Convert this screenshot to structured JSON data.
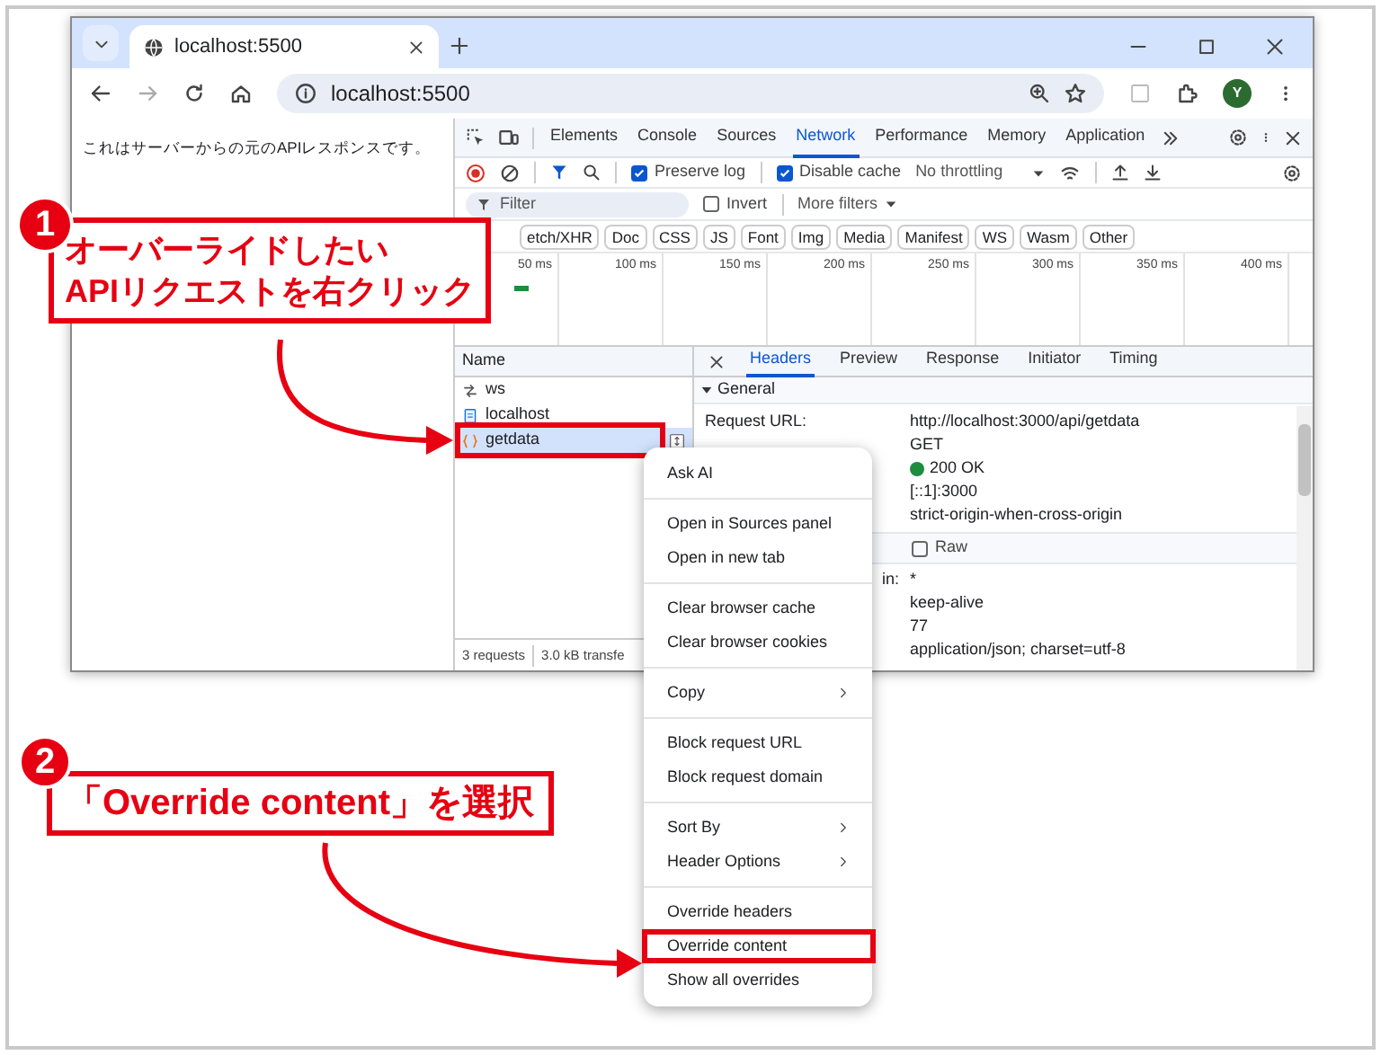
{
  "browser": {
    "tabs": [
      {
        "title": "localhost:5500",
        "selected": true
      }
    ],
    "address": "localhost:5500",
    "profile_initial": "Y"
  },
  "page": {
    "text": "これはサーバーからの元のAPIレスポンスです。"
  },
  "devtools": {
    "tabs": [
      {
        "label": "Elements",
        "selected": false
      },
      {
        "label": "Console",
        "selected": false
      },
      {
        "label": "Sources",
        "selected": false
      },
      {
        "label": "Network",
        "selected": true
      },
      {
        "label": "Performance",
        "selected": false
      },
      {
        "label": "Memory",
        "selected": false
      },
      {
        "label": "Application",
        "selected": false
      }
    ],
    "toolbar": {
      "preserve_log": {
        "label": "Preserve log",
        "checked": true
      },
      "disable_cache": {
        "label": "Disable cache",
        "checked": true
      },
      "throttling": "No throttling"
    },
    "filter": {
      "placeholder": "Filter",
      "invert": {
        "label": "Invert",
        "checked": false
      },
      "more_filters": "More filters"
    },
    "type_filters": [
      "etch/XHR",
      "Doc",
      "CSS",
      "JS",
      "Font",
      "Img",
      "Media",
      "Manifest",
      "WS",
      "Wasm",
      "Other"
    ],
    "timeline_ticks": [
      "50 ms",
      "100 ms",
      "150 ms",
      "200 ms",
      "250 ms",
      "300 ms",
      "350 ms",
      "400 ms"
    ],
    "requests": {
      "column": "Name",
      "rows": [
        {
          "name": "ws",
          "kind": "websocket",
          "selected": false,
          "highlighted": false
        },
        {
          "name": "localhost",
          "kind": "document",
          "selected": false,
          "highlighted": false
        },
        {
          "name": "getdata",
          "kind": "fetch",
          "selected": true,
          "highlighted": true
        }
      ],
      "footer": [
        "3 requests",
        "3.0 kB transfe"
      ]
    },
    "details": {
      "tabs": [
        {
          "label": "Headers",
          "selected": true
        },
        {
          "label": "Preview",
          "selected": false
        },
        {
          "label": "Response",
          "selected": false
        },
        {
          "label": "Initiator",
          "selected": false
        },
        {
          "label": "Timing",
          "selected": false
        }
      ],
      "general": {
        "title": "General",
        "expanded": true,
        "rows": [
          {
            "label": "Request URL:",
            "value": "http://localhost:3000/api/getdata"
          },
          {
            "value": "GET"
          },
          {
            "value": "200 OK",
            "kind": "status"
          },
          {
            "value": "[::1]:3000"
          },
          {
            "value": "strict-origin-when-cross-origin"
          }
        ]
      },
      "response_headers": {
        "raw": {
          "label": "Raw",
          "checked": false
        },
        "rows": [
          {
            "label": "in:",
            "value": "*"
          },
          {
            "value": "keep-alive"
          },
          {
            "value": "77"
          },
          {
            "value": "application/json; charset=utf-8"
          }
        ]
      }
    }
  },
  "context_menu": {
    "groups": [
      [
        {
          "label": "Ask AI",
          "submenu": false,
          "highlighted": false
        }
      ],
      [
        {
          "label": "Open in Sources panel",
          "submenu": false,
          "highlighted": false
        },
        {
          "label": "Open in new tab",
          "submenu": false,
          "highlighted": false
        }
      ],
      [
        {
          "label": "Clear browser cache",
          "submenu": false,
          "highlighted": false
        },
        {
          "label": "Clear browser cookies",
          "submenu": false,
          "highlighted": false
        }
      ],
      [
        {
          "label": "Copy",
          "submenu": true,
          "highlighted": false
        }
      ],
      [
        {
          "label": "Block request URL",
          "submenu": false,
          "highlighted": false
        },
        {
          "label": "Block request domain",
          "submenu": false,
          "highlighted": false
        }
      ],
      [
        {
          "label": "Sort By",
          "submenu": true,
          "highlighted": false
        },
        {
          "label": "Header Options",
          "submenu": true,
          "highlighted": false
        }
      ],
      [
        {
          "label": "Override headers",
          "submenu": false,
          "highlighted": false
        },
        {
          "label": "Override content",
          "submenu": false,
          "highlighted": true
        },
        {
          "label": "Show all overrides",
          "submenu": false,
          "highlighted": false
        }
      ]
    ]
  },
  "annotations": [
    {
      "number": "1",
      "lines": [
        "オーバーライドしたい",
        "APIリクエストを右クリック"
      ]
    },
    {
      "number": "2",
      "lines": [
        "「Override content」を選択"
      ]
    }
  ]
}
